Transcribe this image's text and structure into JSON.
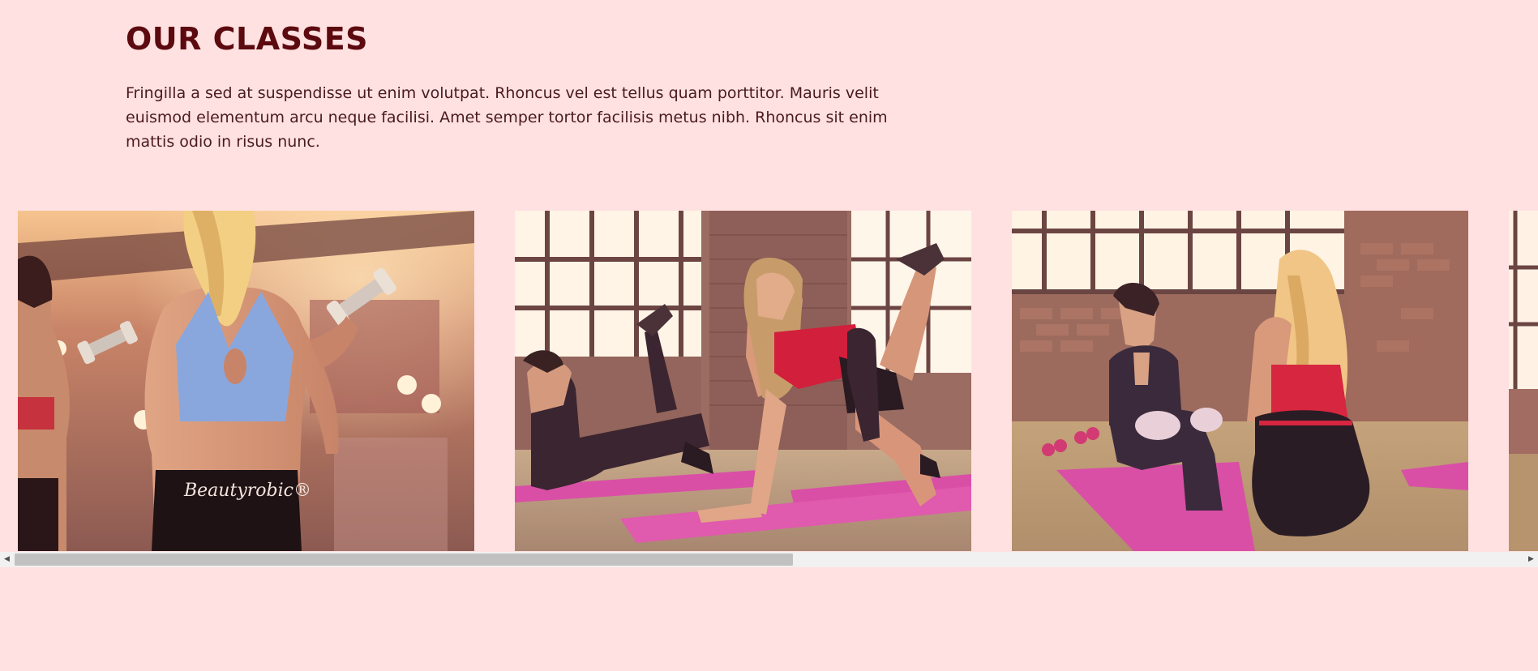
{
  "section": {
    "title": "OUR CLASSES",
    "description": "Fringilla a sed at suspendisse ut enim volutpat. Rhoncus vel est tellus quam porttitor. Mauris velit euismod elementum arcu neque facilisi. Amet semper tortor facilisis metus nibh. Rhoncus sit enim mattis odio in risus nunc."
  },
  "gallery": {
    "slides": [
      {
        "label": "Dumbbell class photo",
        "shirt_text": "Beautyrobic®"
      },
      {
        "label": "Mat kickback class photo"
      },
      {
        "label": "Partner stretch class photo"
      },
      {
        "label": "Partially visible class photo"
      }
    ]
  },
  "scrollbar": {
    "left_arrow": "◀",
    "right_arrow": "▶"
  },
  "colors": {
    "background": "#ffe1e1",
    "title": "#5c0a0f",
    "text": "#4a1a1e",
    "scroll_track": "#f1f1f1",
    "scroll_thumb": "#c1c1c1"
  }
}
